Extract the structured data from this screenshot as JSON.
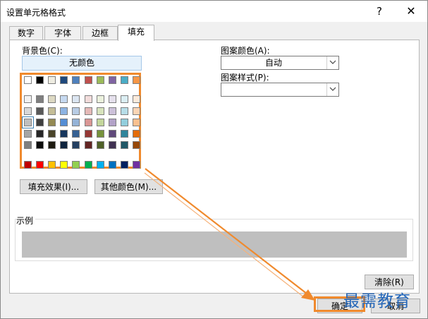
{
  "window": {
    "title": "设置单元格格式",
    "help_glyph": "?",
    "close_glyph": "✕"
  },
  "tabs": [
    {
      "label": "数字",
      "active": false
    },
    {
      "label": "字体",
      "active": false
    },
    {
      "label": "边框",
      "active": false
    },
    {
      "label": "填充",
      "active": true
    }
  ],
  "fill": {
    "background_label": "背景色(C):",
    "no_color_button": "无颜色",
    "fill_effects_button": "填充效果(I)...",
    "more_colors_button": "其他颜色(M)..."
  },
  "pattern": {
    "color_label": "图案颜色(A):",
    "color_value": "自动",
    "style_label": "图案样式(P):",
    "style_value": ""
  },
  "sample": {
    "label": "示例",
    "fill_color": "#bfbfbf"
  },
  "buttons": {
    "clear": "清除(R)",
    "ok": "确定",
    "cancel": "取消"
  },
  "watermark": "最需教育",
  "accent_color": "#f08a2d",
  "palette": {
    "theme_row": [
      "#ffffff",
      "#000000",
      "#eeece1",
      "#1f497d",
      "#4f81bd",
      "#c0504d",
      "#9bbb59",
      "#8064a2",
      "#4bacc6",
      "#f79646"
    ],
    "tint_rows": [
      [
        "#f2f2f2",
        "#7f7f7f",
        "#ddd9c3",
        "#c6d9f0",
        "#dbe5f1",
        "#f2dcdb",
        "#ebf1dd",
        "#e5e0ec",
        "#dbeef3",
        "#fdeada"
      ],
      [
        "#d8d8d8",
        "#595959",
        "#c4bd97",
        "#8db3e2",
        "#b8cce4",
        "#e5b9b7",
        "#d7e3bc",
        "#ccc1d9",
        "#b7dde8",
        "#fbd5b5"
      ],
      [
        "#bfbfbf",
        "#3f3f3f",
        "#938953",
        "#548dd4",
        "#95b3d7",
        "#d99694",
        "#c3d69b",
        "#b2a2c7",
        "#92cddc",
        "#fac08f"
      ],
      [
        "#a5a5a5",
        "#262626",
        "#494429",
        "#17365d",
        "#366092",
        "#953734",
        "#76923c",
        "#5f497a",
        "#31859b",
        "#e36c09"
      ],
      [
        "#7f7f7f",
        "#0c0c0c",
        "#1d1b10",
        "#0f243e",
        "#244061",
        "#632423",
        "#4f6128",
        "#3f3151",
        "#205867",
        "#974806"
      ]
    ],
    "standard_row": [
      "#c00000",
      "#ff0000",
      "#ffc000",
      "#ffff00",
      "#92d050",
      "#00b050",
      "#00b0f0",
      "#0070c0",
      "#002060",
      "#7030a0"
    ],
    "selected": "#bfbfbf"
  }
}
